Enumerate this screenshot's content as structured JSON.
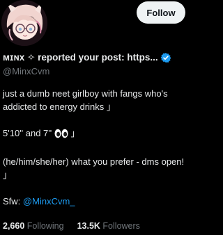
{
  "profile": {
    "display_name": "ᴍɪɴx ✧ reported your post: https...",
    "handle": "@MinxCvm",
    "follow_label": "Follow",
    "verified": true
  },
  "bio": {
    "line1": "just a dumb neet girlboy with fangs who's addicted to energy drinks 」",
    "line2_text": "5'10'' and 7''",
    "line2_suffix": "」",
    "line3": "(he/him/she/her) what you prefer - dms open! 」",
    "sfw_label": "Sfw:",
    "sfw_link": "@MinxCvm_"
  },
  "stats": {
    "following_count": "2,660",
    "following_label": "Following",
    "followers_count": "13.5K",
    "followers_label": "Followers"
  },
  "colors": {
    "background": "#000000",
    "text": "#e7e9ea",
    "secondary": "#71767b",
    "link": "#1d9bf0",
    "button_bg": "#eff3f4"
  },
  "icons": {
    "verified": "verified-badge-icon",
    "eyes": "eyes-emoji-icon"
  }
}
